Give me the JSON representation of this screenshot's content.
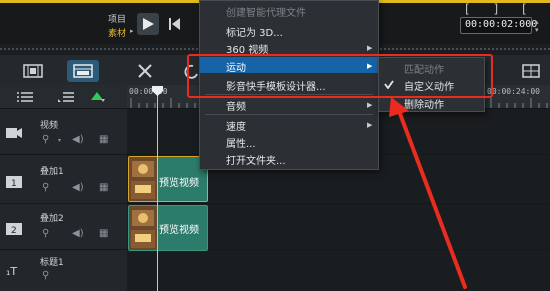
{
  "preview": {
    "mode_project": "项目",
    "mode_clip": "素材",
    "mode_arrow": "▸",
    "timecode": "00:00:02:000",
    "bracket_icons": "[ ] [ ]"
  },
  "context_menu": {
    "items": [
      {
        "label": "创建智能代理文件",
        "disabled": true
      },
      {
        "label": "标记为 3D...",
        "disabled": false
      },
      {
        "label": "360 视频",
        "has_submenu": true
      },
      {
        "label": "运动",
        "has_submenu": true,
        "highlighted": true
      },
      {
        "label": "影音快手模板设计器...",
        "disabled": false
      },
      {
        "label": "音频",
        "has_submenu": true
      },
      {
        "label": "速度",
        "has_submenu": true
      },
      {
        "label": "属性...",
        "disabled": false
      },
      {
        "label": "打开文件夹...",
        "disabled": false
      }
    ],
    "submenu_arrow": "▶"
  },
  "submenu": {
    "items": [
      {
        "label": "匹配动作",
        "disabled": true,
        "checked": false
      },
      {
        "label": "自定义动作",
        "disabled": false,
        "checked": true
      },
      {
        "label": "删除动作",
        "disabled": false,
        "checked": false
      }
    ]
  },
  "ruler": {
    "timecode_start": "00:00:00",
    "timecode_end": "00:00:24:00"
  },
  "tracks": [
    {
      "name": "视频",
      "badge": "video-track-icon"
    },
    {
      "name": "叠加1",
      "badge": "overlay-track-1-icon"
    },
    {
      "name": "叠加2",
      "badge": "overlay-track-2-icon"
    },
    {
      "name": "标题1",
      "badge": "title-track-icon"
    }
  ],
  "clips": [
    {
      "track": "叠加1",
      "label": "预览视频"
    },
    {
      "track": "叠加2",
      "label": "预览视频"
    }
  ],
  "colors": {
    "highlight": "#1763a8",
    "annotation": "#ea2b1f",
    "clip": "#2c7c6c",
    "accent_yellow": "#e1b91d"
  }
}
